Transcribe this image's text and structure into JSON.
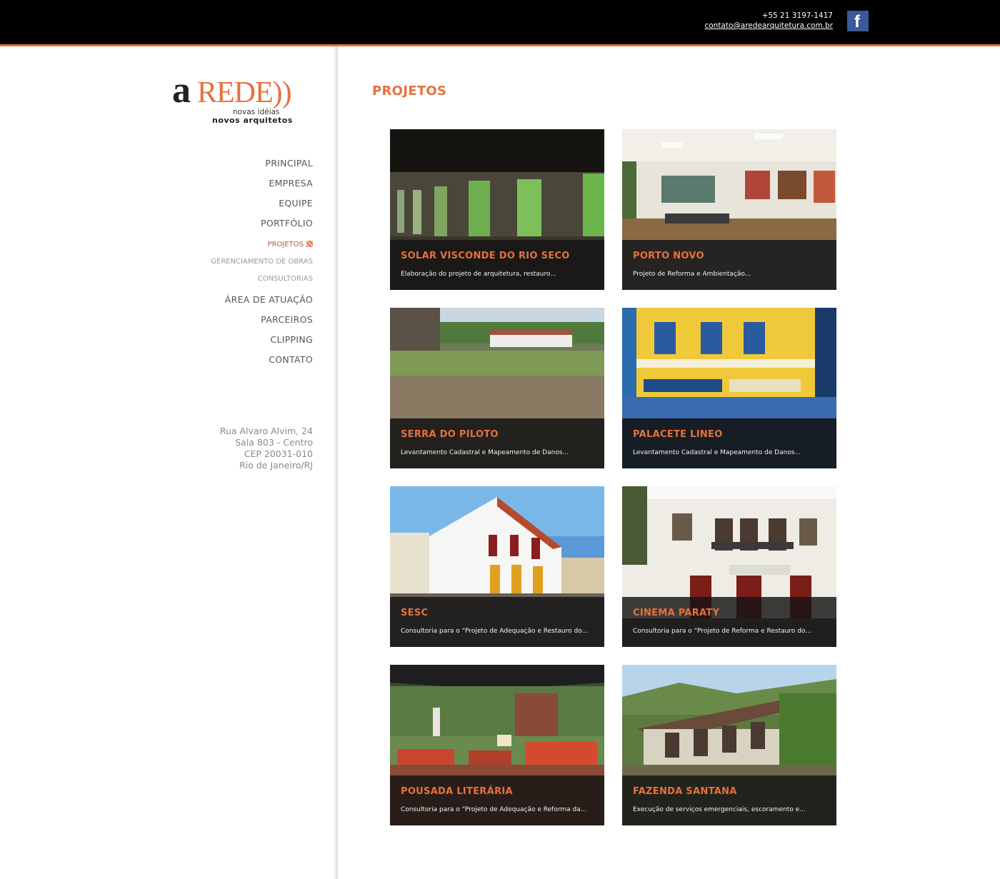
{
  "header": {
    "phone": "+55 21 3197-1417",
    "email": "contato@aredearquitetura.com.br",
    "facebook_icon": "facebook-icon"
  },
  "logo": {
    "a": "a",
    "rede": "REDE))",
    "tagline_1": "novas idéias",
    "tagline_2": "novos arquitetos"
  },
  "nav": {
    "items": [
      {
        "label": "PRINCIPAL"
      },
      {
        "label": "EMPRESA"
      },
      {
        "label": "EQUIPE"
      },
      {
        "label": "PORTFÓLIO"
      },
      {
        "label": "PROJETOS"
      },
      {
        "label": "GERENCIAMENTO DE OBRAS"
      },
      {
        "label": "CONSULTORIAS"
      },
      {
        "label": "ÁREA DE ATUAÇÃO"
      },
      {
        "label": "PARCEIROS"
      },
      {
        "label": "CLIPPING"
      },
      {
        "label": "CONTATO"
      }
    ]
  },
  "address": {
    "line1": "Rua Alvaro Alvim, 24",
    "line2": "Sala 803 - Centro",
    "line3": "CEP 20031-010",
    "line4": "Rio de Janeiro/RJ"
  },
  "page": {
    "title": "PROJETOS"
  },
  "projects": [
    {
      "title": "SOLAR VISCONDE DO RIO SECO",
      "desc": "Elaboração do projeto de arquitetura, restauro..."
    },
    {
      "title": "PORTO NOVO",
      "desc": "Projeto de Reforma e Ambientação..."
    },
    {
      "title": "SERRA DO PILOTO",
      "desc": "Levantamento Cadastral e Mapeamento de Danos..."
    },
    {
      "title": "PALACETE LINEO",
      "desc": "Levantamento Cadastral e Mapeamento de Danos..."
    },
    {
      "title": "SESC",
      "desc": "Consultoria para o “Projeto de Adequação e Restauro do..."
    },
    {
      "title": "CINEMA PARATY",
      "desc": "Consultoria para o “Projeto de Reforma e Restauro do..."
    },
    {
      "title": "POUSADA LITERÁRIA",
      "desc": "Consultoria para o “Projeto de Adequação e Reforma da..."
    },
    {
      "title": "FAZENDA SANTANA",
      "desc": "Execução de serviços emergenciais, escoramento e..."
    }
  ],
  "colors": {
    "accent": "#e8703c",
    "topbar": "#000000",
    "facebook": "#3b5998"
  }
}
